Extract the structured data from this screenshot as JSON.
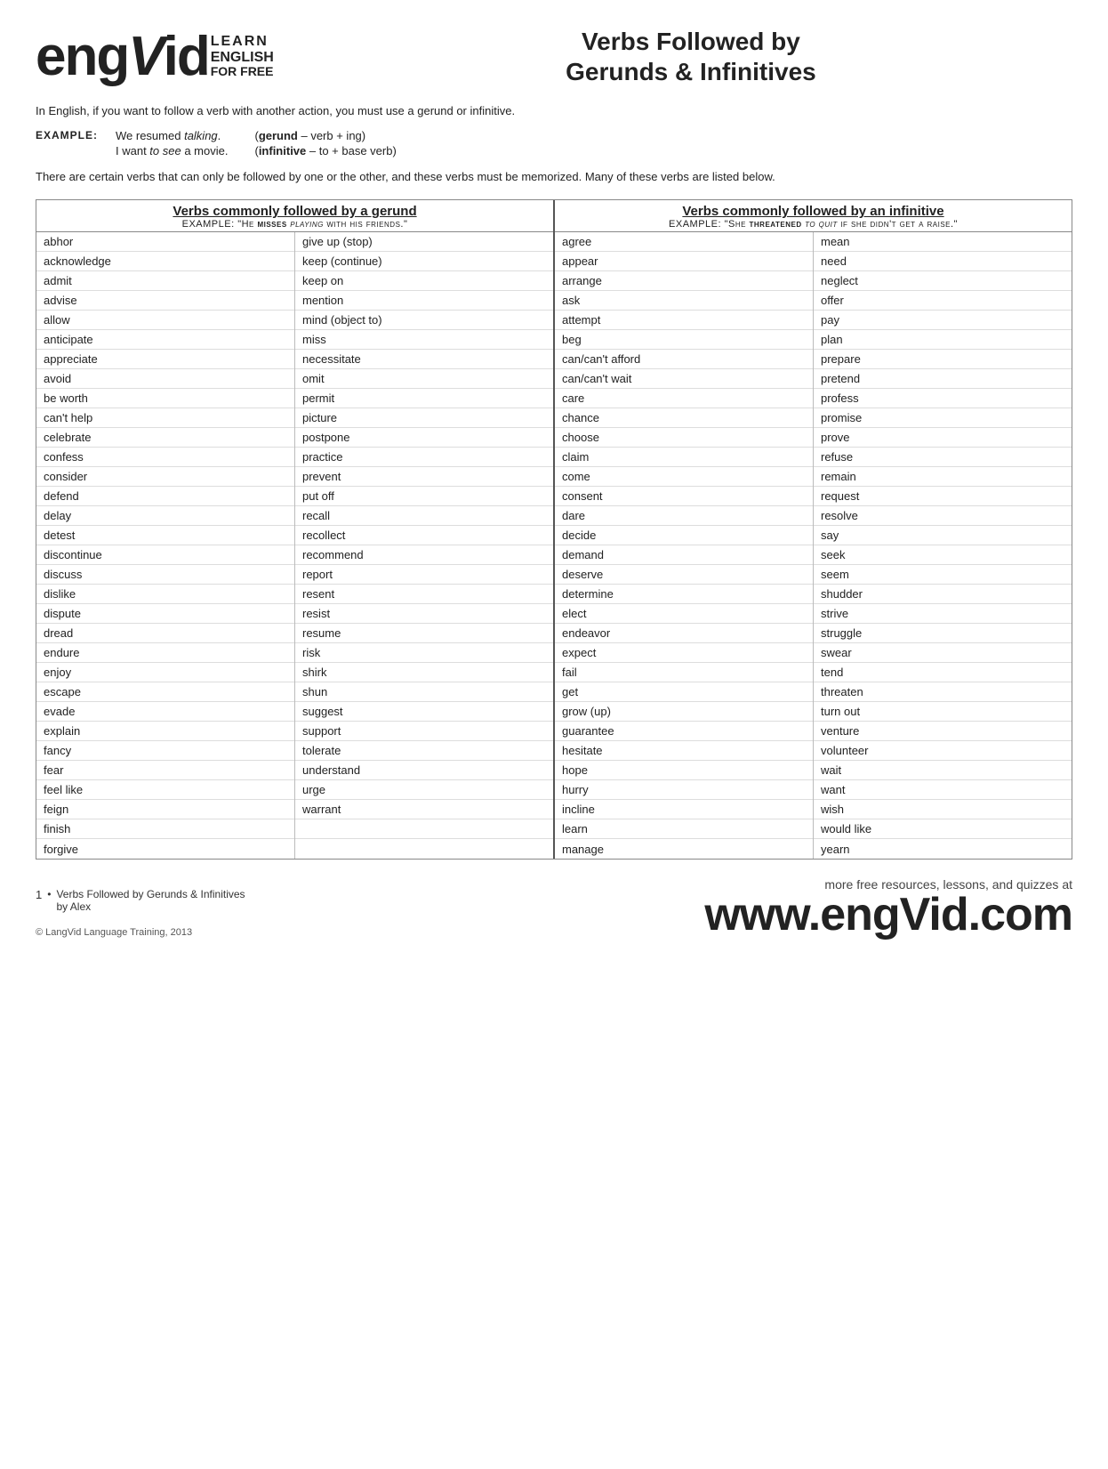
{
  "header": {
    "logo_large": "engVid",
    "logo_learn": "LEARN",
    "logo_english": "ENGLISH",
    "logo_forfree": "FOR FREE",
    "page_title": "Verbs Followed by\nGerunds & Infinitives"
  },
  "intro": {
    "text": "In English, if you want to follow a verb with another action, you must use a gerund or infinitive.",
    "example_label": "EXAMPLE:",
    "example1_sentence": "We resumed ",
    "example1_italic": "talking",
    "example1_end": ".",
    "example2_pre": "I want ",
    "example2_italic": "to see",
    "example2_end": " a movie.",
    "def1_bold": "gerund",
    "def1_rest": " – verb + ing)",
    "def2_bold": "infinitive",
    "def2_rest": " – to + base verb)",
    "def1_paren": "(",
    "def2_paren": "("
  },
  "note": "There are certain verbs that can only be followed by one or the other, and these verbs must be memorized. Many of these verbs are listed below.",
  "gerund_section": {
    "title": "Verbs commonly followed by a gerund",
    "example_label": "EXAMPLE:",
    "example_pre": "“He ",
    "example_bold": "misses",
    "example_italic": " playing",
    "example_end": " with his friends.”",
    "col1": [
      "abhor",
      "acknowledge",
      "admit",
      "advise",
      "allow",
      "anticipate",
      "appreciate",
      "avoid",
      "be worth",
      "can't help",
      "celebrate",
      "confess",
      "consider",
      "defend",
      "delay",
      "detest",
      "discontinue",
      "discuss",
      "dislike",
      "dispute",
      "dread",
      "endure",
      "enjoy",
      "escape",
      "evade",
      "explain",
      "fancy",
      "fear",
      "feel like",
      "feign",
      "finish",
      "forgive"
    ],
    "col2": [
      "give up (stop)",
      "keep (continue)",
      "keep on",
      "mention",
      "mind (object to)",
      "miss",
      "necessitate",
      "omit",
      "permit",
      "picture",
      "postpone",
      "practice",
      "prevent",
      "put off",
      "recall",
      "recollect",
      "recommend",
      "report",
      "resent",
      "resist",
      "resume",
      "risk",
      "shirk",
      "shun",
      "suggest",
      "support",
      "tolerate",
      "understand",
      "urge",
      "warrant",
      "",
      ""
    ]
  },
  "infinitive_section": {
    "title": "Verbs commonly followed by an infinitive",
    "example_label": "EXAMPLE:",
    "example_pre": "“She ",
    "example_bold": "threatened",
    "example_italic": " to quit",
    "example_end": " if she didn't get a raise.”",
    "col1": [
      "agree",
      "appear",
      "arrange",
      "ask",
      "attempt",
      "beg",
      "can/can't afford",
      "can/can't wait",
      "care",
      "chance",
      "choose",
      "claim",
      "come",
      "consent",
      "dare",
      "decide",
      "demand",
      "deserve",
      "determine",
      "elect",
      "endeavor",
      "expect",
      "fail",
      "get",
      "grow (up)",
      "guarantee",
      "hesitate",
      "hope",
      "hurry",
      "incline",
      "learn",
      "manage"
    ],
    "col2": [
      "mean",
      "need",
      "neglect",
      "offer",
      "pay",
      "plan",
      "prepare",
      "pretend",
      "profess",
      "promise",
      "prove",
      "refuse",
      "remain",
      "request",
      "resolve",
      "say",
      "seek",
      "seem",
      "shudder",
      "strive",
      "struggle",
      "swear",
      "tend",
      "threaten",
      "turn out",
      "venture",
      "volunteer",
      "wait",
      "want",
      "wish",
      "would like",
      "yearn"
    ]
  },
  "footer": {
    "bullet_num": "1",
    "lesson_line1": "Verbs Followed by Gerunds & Infinitives",
    "lesson_line2": "by Alex",
    "copyright": "© LangVid Language Training, 2013",
    "more_text": "more free resources, lessons, and quizzes at",
    "website": "www.engVid.com"
  }
}
